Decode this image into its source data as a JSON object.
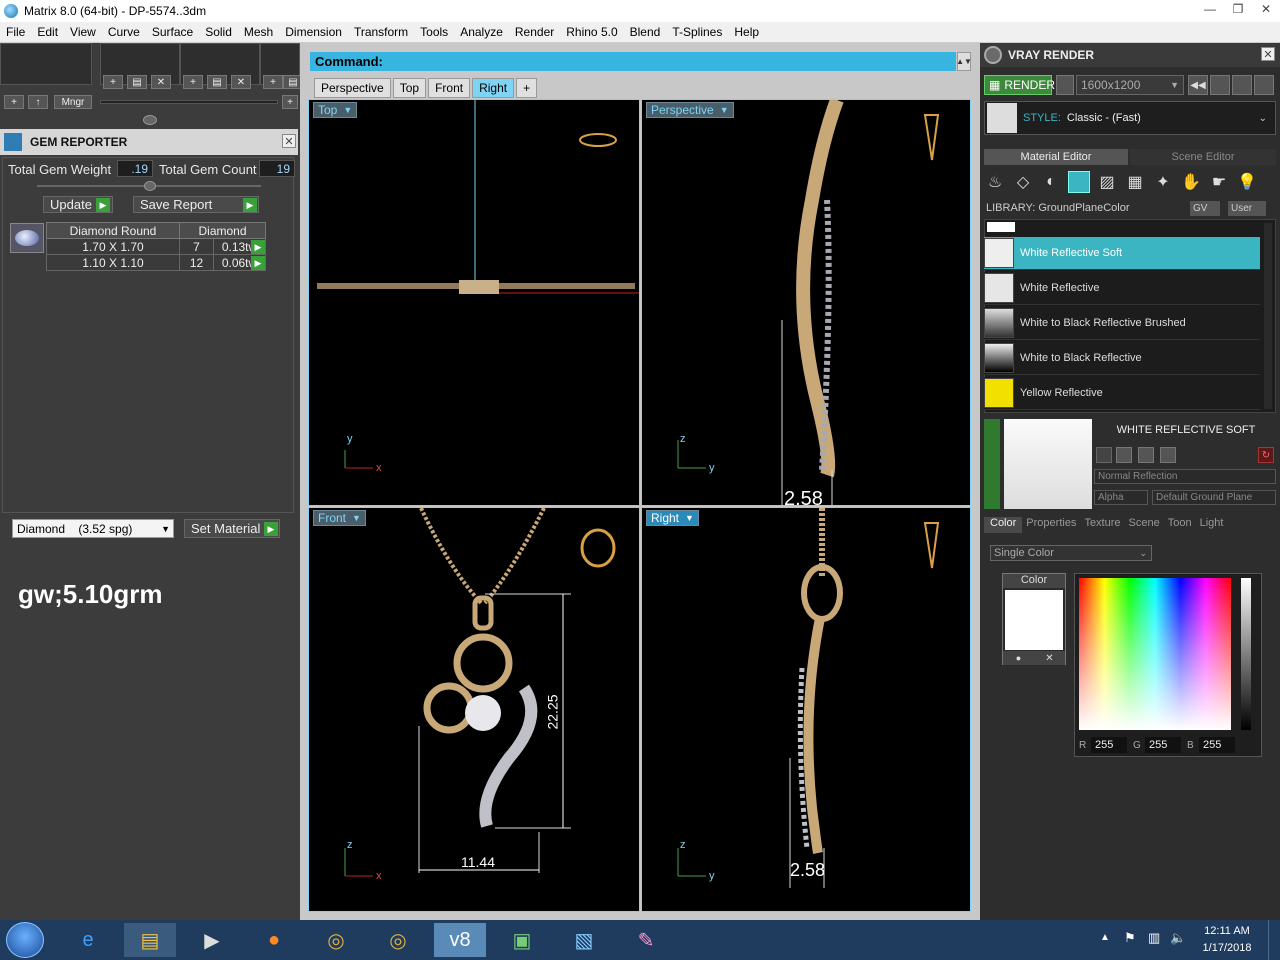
{
  "window": {
    "title": "Matrix 8.0 (64-bit) - DP-5574..3dm"
  },
  "menu": [
    "File",
    "Edit",
    "View",
    "Curve",
    "Surface",
    "Solid",
    "Mesh",
    "Dimension",
    "Transform",
    "Tools",
    "Analyze",
    "Render",
    "Rhino 5.0",
    "Blend",
    "T-Splines",
    "Help"
  ],
  "left_toolbar": {
    "mngr": "Mngr"
  },
  "gem_reporter": {
    "title": "GEM REPORTER",
    "total_weight_label": "Total Gem Weight",
    "total_weight": ".19",
    "total_count_label": "Total Gem Count",
    "total_count": "19",
    "update": "Update",
    "save_report": "Save Report",
    "table": {
      "headers": [
        "Diamond Round",
        "Diamond"
      ],
      "rows": [
        {
          "size": "1.70 X 1.70",
          "count": "7",
          "weight": "0.13tw"
        },
        {
          "size": "1.10 X 1.10",
          "count": "12",
          "weight": "0.06tw"
        }
      ]
    },
    "material_select": "Diamond    (3.52 spg)",
    "set_material": "Set Material",
    "note": "gw;5.10grm"
  },
  "command": {
    "label": "Command:"
  },
  "viewport_tabs": [
    "Perspective",
    "Top",
    "Front",
    "Right"
  ],
  "viewports": {
    "top": {
      "label": "Top"
    },
    "perspective": {
      "label": "Perspective",
      "dim": "2.58"
    },
    "front": {
      "label": "Front",
      "width_dim": "11.44",
      "height_dim": "22.25"
    },
    "right": {
      "label": "Right",
      "dim": "2.58"
    }
  },
  "vray": {
    "title": "VRAY RENDER",
    "render": "RENDER",
    "resolution": "1600x1200",
    "style_label": "STYLE:",
    "style_value": "Classic - (Fast)",
    "tabs": [
      "Material Editor",
      "Scene Editor"
    ],
    "library_label": "LIBRARY: GroundPlaneColor",
    "gv": "GV",
    "user": "User",
    "materials": [
      {
        "name": "White Reflective Soft",
        "selected": true
      },
      {
        "name": "White Reflective",
        "selected": false
      },
      {
        "name": "White to Black Reflective Brushed",
        "selected": false
      },
      {
        "name": "White to Black Reflective",
        "selected": false
      },
      {
        "name": "Yellow Reflective",
        "selected": false
      }
    ],
    "selected_name": "WHITE REFLECTIVE SOFT",
    "reflection": "Normal Reflection",
    "alpha": "Alpha",
    "ground": "Default Ground Plane",
    "prop_tabs": [
      "Color",
      "Properties",
      "Texture",
      "Scene",
      "Toon",
      "Light"
    ],
    "color_mode": "Single Color",
    "color_label": "Color",
    "rgb": {
      "r_label": "R",
      "r": "255",
      "g_label": "G",
      "g": "255",
      "b_label": "B",
      "b": "255"
    }
  },
  "taskbar": {
    "time": "12:11 AM",
    "date": "1/17/2018"
  }
}
